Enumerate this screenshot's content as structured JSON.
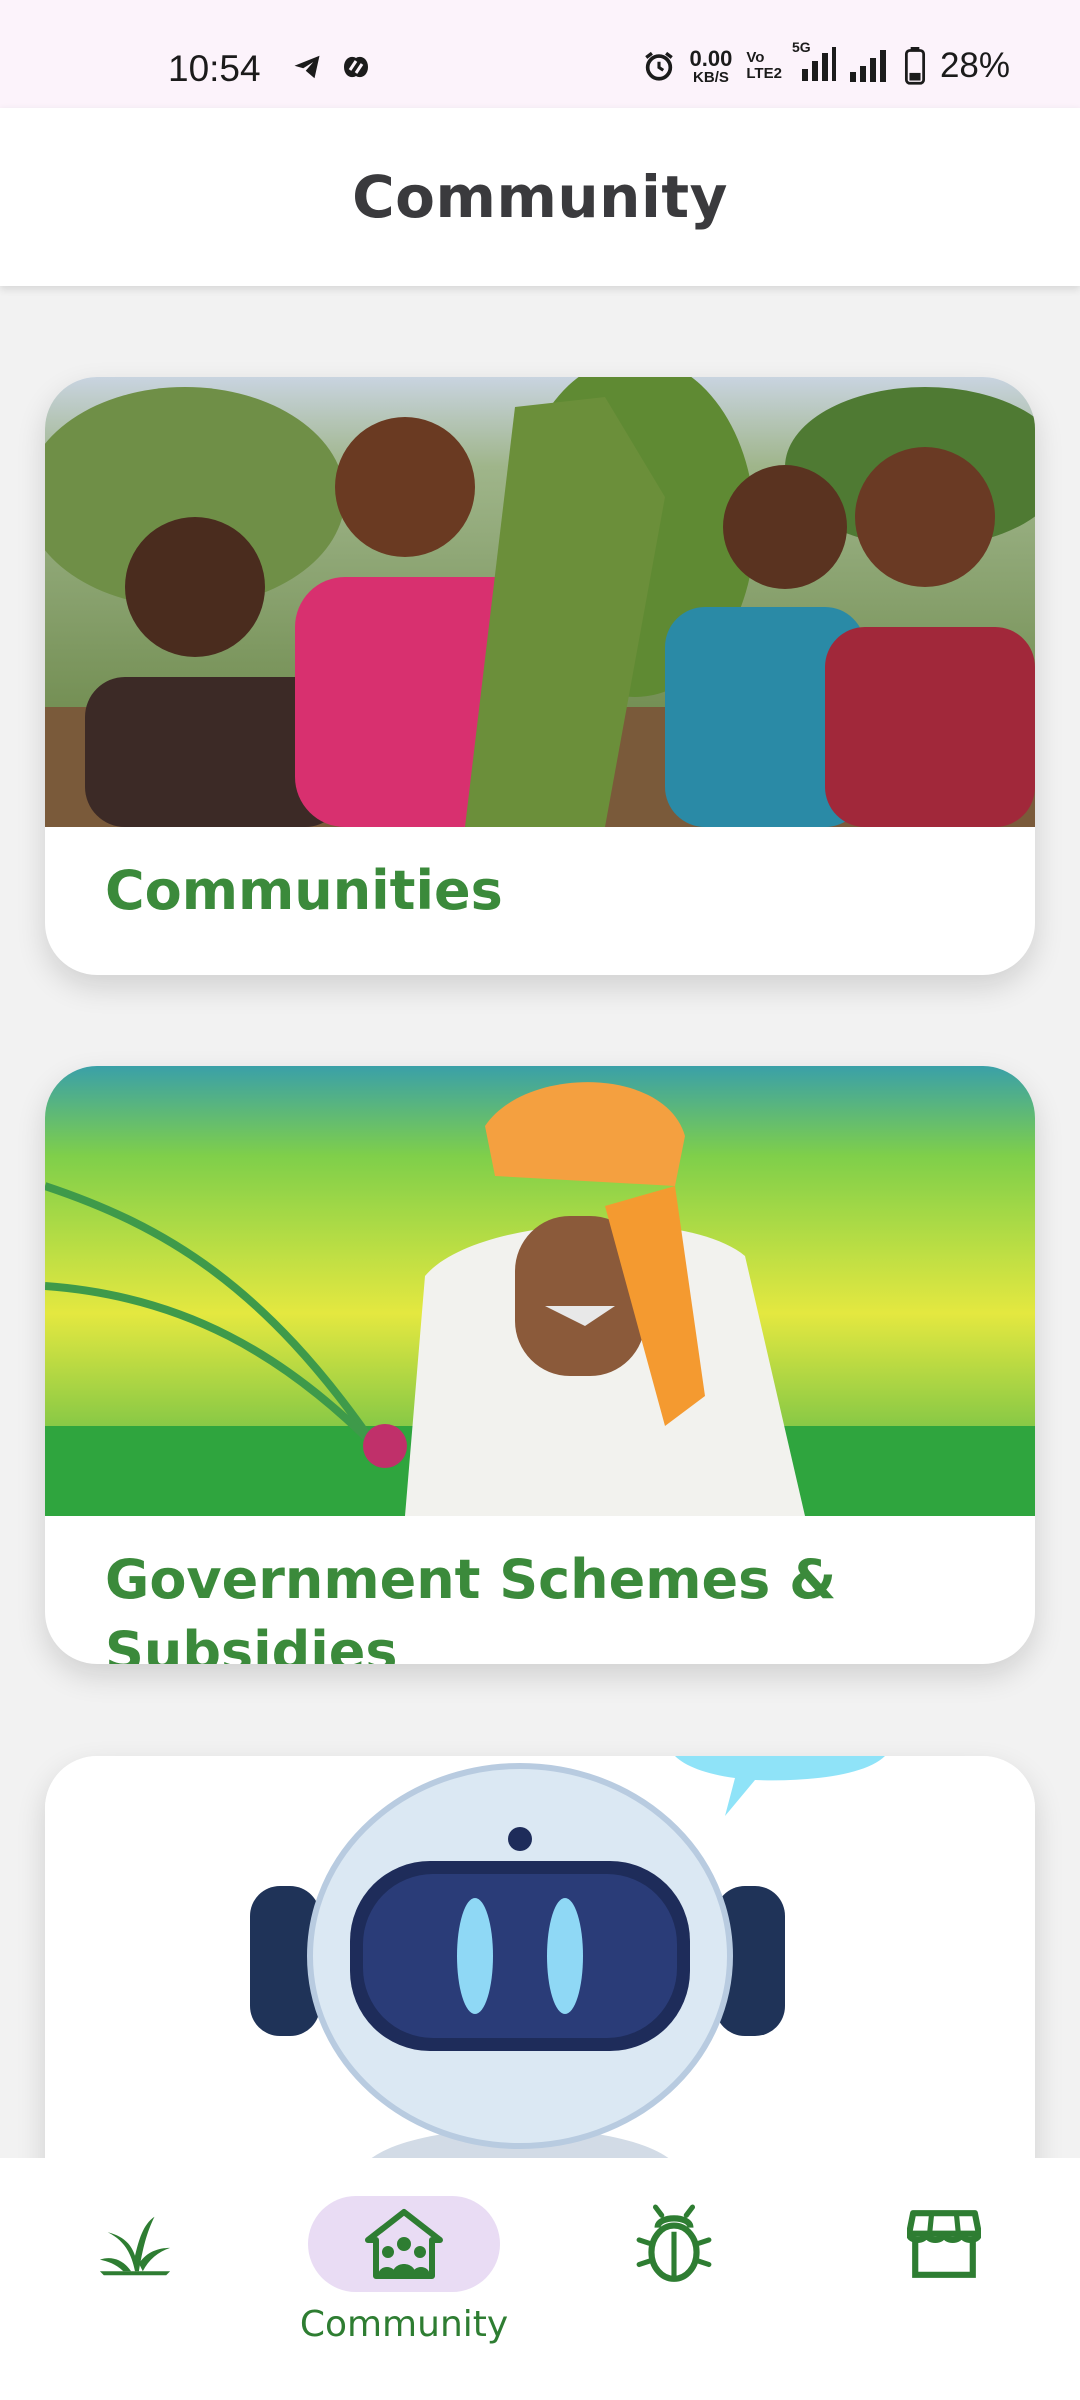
{
  "status_bar": {
    "time": "10:54",
    "net_speed_value": "0.00",
    "net_speed_unit": "KB/S",
    "volte_line1": "Vo",
    "volte_line2": "LTE2",
    "network": "5G",
    "battery": "28%"
  },
  "header": {
    "title": "Community"
  },
  "cards": [
    {
      "label": "Communities",
      "image": "women-farmers-photo"
    },
    {
      "label": "Government Schemes & Subsidies",
      "image": "farmer-with-onions-photo"
    },
    {
      "label": "",
      "image": "robot-assistant-illustration"
    }
  ],
  "bottom_nav": {
    "items": [
      {
        "icon": "crop-sprout-icon",
        "label": ""
      },
      {
        "icon": "community-house-icon",
        "label": "Community",
        "active": true
      },
      {
        "icon": "bug-icon",
        "label": ""
      },
      {
        "icon": "store-icon",
        "label": ""
      }
    ]
  },
  "colors": {
    "accent_green": "#3b8a3b",
    "nav_active_pill": "#e9dcf4",
    "status_bar_bg": "#fcf3fb"
  }
}
